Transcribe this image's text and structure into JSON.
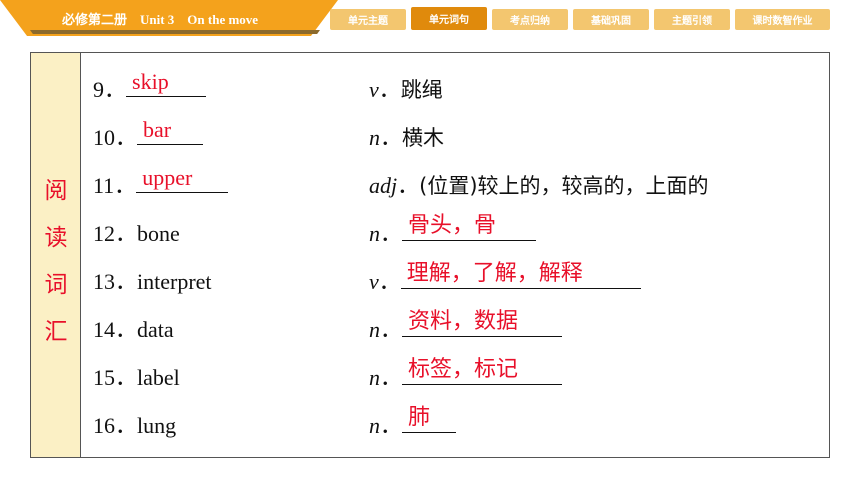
{
  "header": {
    "title": "必修第二册    Unit 3    On the move",
    "nav": [
      {
        "label": "单元主题",
        "active": false
      },
      {
        "label": "单元词句",
        "active": true
      },
      {
        "label": "考点归纳",
        "active": false
      },
      {
        "label": "基础巩固",
        "active": false
      },
      {
        "label": "主题引领",
        "active": false
      },
      {
        "label": "课时数智作业",
        "active": false
      }
    ]
  },
  "section_label": [
    "阅",
    "读",
    "词",
    "汇"
  ],
  "rows": [
    {
      "num": "9．",
      "word": "",
      "answer": "skip",
      "pos": "v",
      "meaning": "跳绳",
      "meaning_answer": ""
    },
    {
      "num": "10．",
      "word": "",
      "answer": "bar",
      "pos": "n",
      "meaning": "横木",
      "meaning_answer": ""
    },
    {
      "num": "11．",
      "word": "",
      "answer": "upper",
      "pos": "adj",
      "meaning": "(位置)较上的，较高的，上面的",
      "meaning_answer": ""
    },
    {
      "num": "12．",
      "word": "bone",
      "answer": "",
      "pos": "n",
      "meaning": "",
      "meaning_answer": "骨头，骨"
    },
    {
      "num": "13．",
      "word": "interpret",
      "answer": "",
      "pos": "v",
      "meaning": "",
      "meaning_answer": "理解，了解，解释"
    },
    {
      "num": "14．",
      "word": "data",
      "answer": "",
      "pos": "n",
      "meaning": "",
      "meaning_answer": "资料，数据"
    },
    {
      "num": "15．",
      "word": "label",
      "answer": "",
      "pos": "n",
      "meaning": "",
      "meaning_answer": "标签，标记"
    },
    {
      "num": "16．",
      "word": "lung",
      "answer": "",
      "pos": "n",
      "meaning": "",
      "meaning_answer": "肺"
    }
  ],
  "colors": {
    "accent": "#f4a21c",
    "answer": "#e8102a",
    "side_bg": "#fbf0c5"
  }
}
